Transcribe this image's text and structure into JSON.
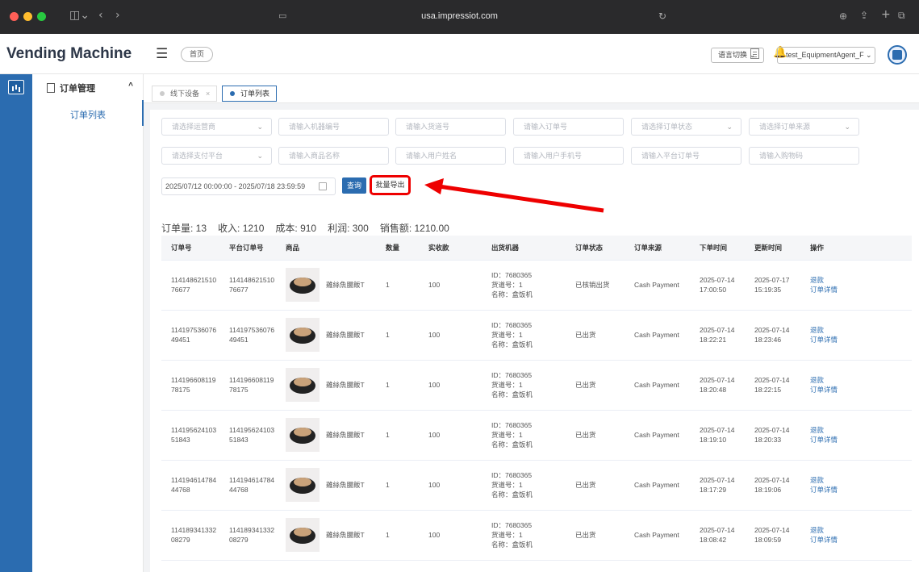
{
  "browser": {
    "url": "usa.impressiot.com"
  },
  "header": {
    "brand": "Vending Machine",
    "home_tag": "首页",
    "language_select": "语言切换 ⌄",
    "user_select": "test_EquipmentAgent_F ⌄"
  },
  "sidebar": {
    "menu_label": "订单管理",
    "sub_items": [
      {
        "label": "订单列表"
      }
    ]
  },
  "tabs": [
    {
      "label": "线下设备"
    },
    {
      "label": "订单列表"
    }
  ],
  "filters": {
    "row1": [
      "请选择运营商",
      "请输入机器编号",
      "请输入货道号",
      "请输入订单号",
      "请选择订单状态",
      "请选择订单来源"
    ],
    "row2": [
      "请选择支付平台",
      "请输入商品名称",
      "请输入用户姓名",
      "请输入用户手机号",
      "请输入平台订单号",
      "请输入购物码"
    ],
    "date_range": "2025/07/12 00:00:00 - 2025/07/18 23:59:59",
    "query_button": "查询",
    "export_button": "批量导出"
  },
  "summary": {
    "order_count": "订单量: 13",
    "income": "收入: 1210",
    "cost": "成本: 910",
    "profit": "利润: 300",
    "sales": "销售额: 1210.00"
  },
  "table": {
    "columns": [
      "订单号",
      "平台订单号",
      "商品",
      "数量",
      "实收款",
      "出货机器",
      "订单状态",
      "订单来源",
      "下单时间",
      "更新时间",
      "操作"
    ],
    "rows": [
      {
        "order_no": "11414862151076677",
        "platform_no": "11414862151076677",
        "goods": "雞絲魚腸飯T",
        "qty": "1",
        "paid": "100",
        "machine": [
          "ID：7680365",
          "货道号：1",
          "名称：盒饭机"
        ],
        "status": "已核销出货",
        "source": "Cash Payment",
        "created": "2025-07-14 17:00:50",
        "updated": "2025-07-17 15:19:35",
        "actions": [
          "退款",
          "订单详情"
        ]
      },
      {
        "order_no": "11419753607649451",
        "platform_no": "11419753607649451",
        "goods": "雞絲魚腸飯T",
        "qty": "1",
        "paid": "100",
        "machine": [
          "ID：7680365",
          "货道号：1",
          "名称：盒饭机"
        ],
        "status": "已出货",
        "source": "Cash Payment",
        "created": "2025-07-14 18:22:21",
        "updated": "2025-07-14 18:23:46",
        "actions": [
          "退款",
          "订单详情"
        ]
      },
      {
        "order_no": "11419660811978175",
        "platform_no": "11419660811978175",
        "goods": "雞絲魚腸飯T",
        "qty": "1",
        "paid": "100",
        "machine": [
          "ID：7680365",
          "货道号：1",
          "名称：盒饭机"
        ],
        "status": "已出货",
        "source": "Cash Payment",
        "created": "2025-07-14 18:20:48",
        "updated": "2025-07-14 18:22:15",
        "actions": [
          "退款",
          "订单详情"
        ]
      },
      {
        "order_no": "11419562410351843",
        "platform_no": "11419562410351843",
        "goods": "雞絲魚腸飯T",
        "qty": "1",
        "paid": "100",
        "machine": [
          "ID：7680365",
          "货道号：1",
          "名称：盒饭机"
        ],
        "status": "已出货",
        "source": "Cash Payment",
        "created": "2025-07-14 18:19:10",
        "updated": "2025-07-14 18:20:33",
        "actions": [
          "退款",
          "订单详情"
        ]
      },
      {
        "order_no": "11419461478444768",
        "platform_no": "11419461478444768",
        "goods": "雞絲魚腸飯T",
        "qty": "1",
        "paid": "100",
        "machine": [
          "ID：7680365",
          "货道号：1",
          "名称：盒饭机"
        ],
        "status": "已出货",
        "source": "Cash Payment",
        "created": "2025-07-14 18:17:29",
        "updated": "2025-07-14 18:19:06",
        "actions": [
          "退款",
          "订单详情"
        ]
      },
      {
        "order_no": "11418934133208279",
        "platform_no": "11418934133208279",
        "goods": "雞絲魚腸飯T",
        "qty": "1",
        "paid": "100",
        "machine": [
          "ID：7680365",
          "货道号：1",
          "名称：盒饭机"
        ],
        "status": "已出货",
        "source": "Cash Payment",
        "created": "2025-07-14 18:08:42",
        "updated": "2025-07-14 18:09:59",
        "actions": [
          "退款",
          "订单详情"
        ]
      }
    ]
  }
}
